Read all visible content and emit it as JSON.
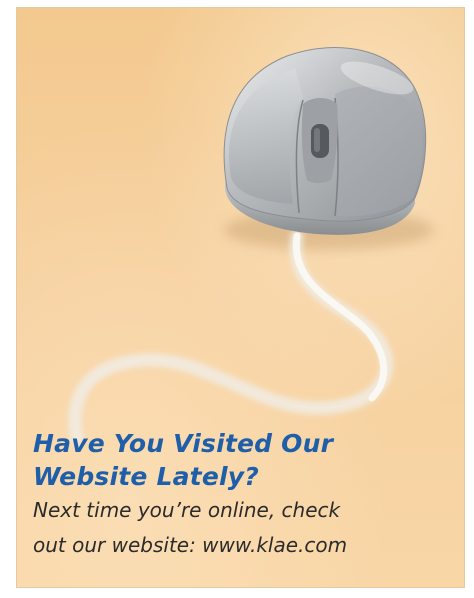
{
  "ad": {
    "headline_line1": "Have You Visited Our",
    "headline_line2": "Website Lately?",
    "body_line1": "Next time you’re online, check",
    "body_line2": "out our website: www.klae.com"
  },
  "image": {
    "subject": "computer-mouse-icon"
  },
  "colors": {
    "background": "#f6d09e",
    "headline": "#1f5ea8",
    "body_text": "#2b2b2b",
    "mouse_body": "#b9bbbd"
  }
}
